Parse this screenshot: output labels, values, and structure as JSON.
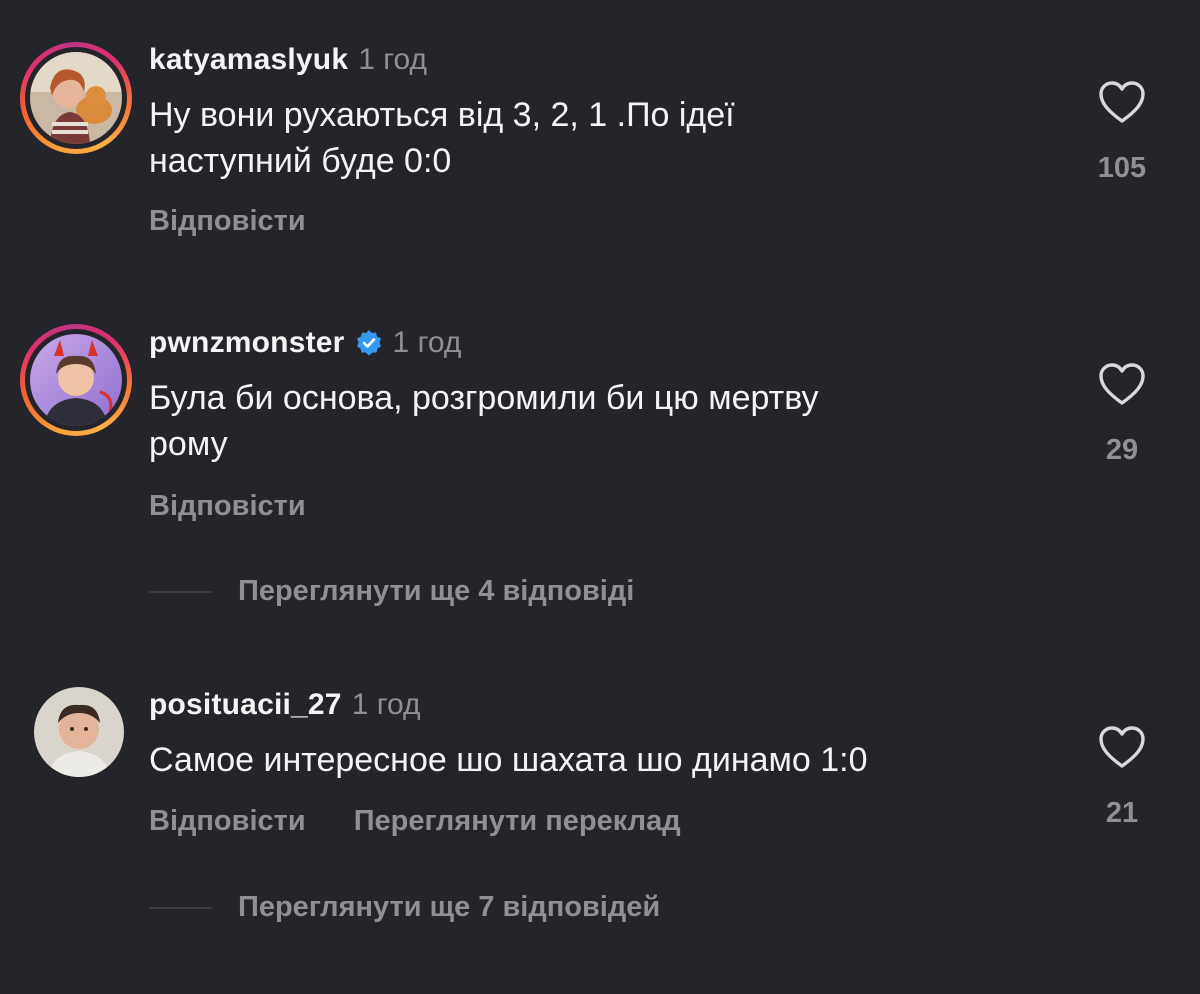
{
  "comments": [
    {
      "username": "katyamaslyuk",
      "time": "1 год",
      "verified": false,
      "text_lines": [
        "Ну вони рухаються від 3, 2, 1 .По ідеї",
        "наступний буде 0:0"
      ],
      "reply_label": "Відповісти",
      "likes": "105",
      "avatar": "avatar-woman-with-cat"
    },
    {
      "username": "pwnzmonster",
      "time": "1 год",
      "verified": true,
      "text_lines": [
        "Була би основа, розгромили би цю мертву",
        "рому"
      ],
      "reply_label": "Відповісти",
      "likes": "29",
      "avatar": "avatar-devil-horns-guy",
      "more_replies": "Переглянути ще 4 відповіді"
    },
    {
      "username": "posituacii_27",
      "time": "1 год",
      "verified": false,
      "text_lines": [
        "Самое интересное шо шахата шо динамо 1:0"
      ],
      "reply_label": "Відповісти",
      "translate_label": "Переглянути переклад",
      "likes": "21",
      "avatar": "avatar-young-man",
      "more_replies": "Переглянути ще 7 відповідей"
    }
  ],
  "colors": {
    "background": "#24252a",
    "primary_text": "#f4f4f4",
    "secondary_text": "#8e9096",
    "verified_badge": "#3897f0"
  },
  "icons": {
    "like": "heart-outline-icon",
    "verified": "verified-badge-icon"
  }
}
